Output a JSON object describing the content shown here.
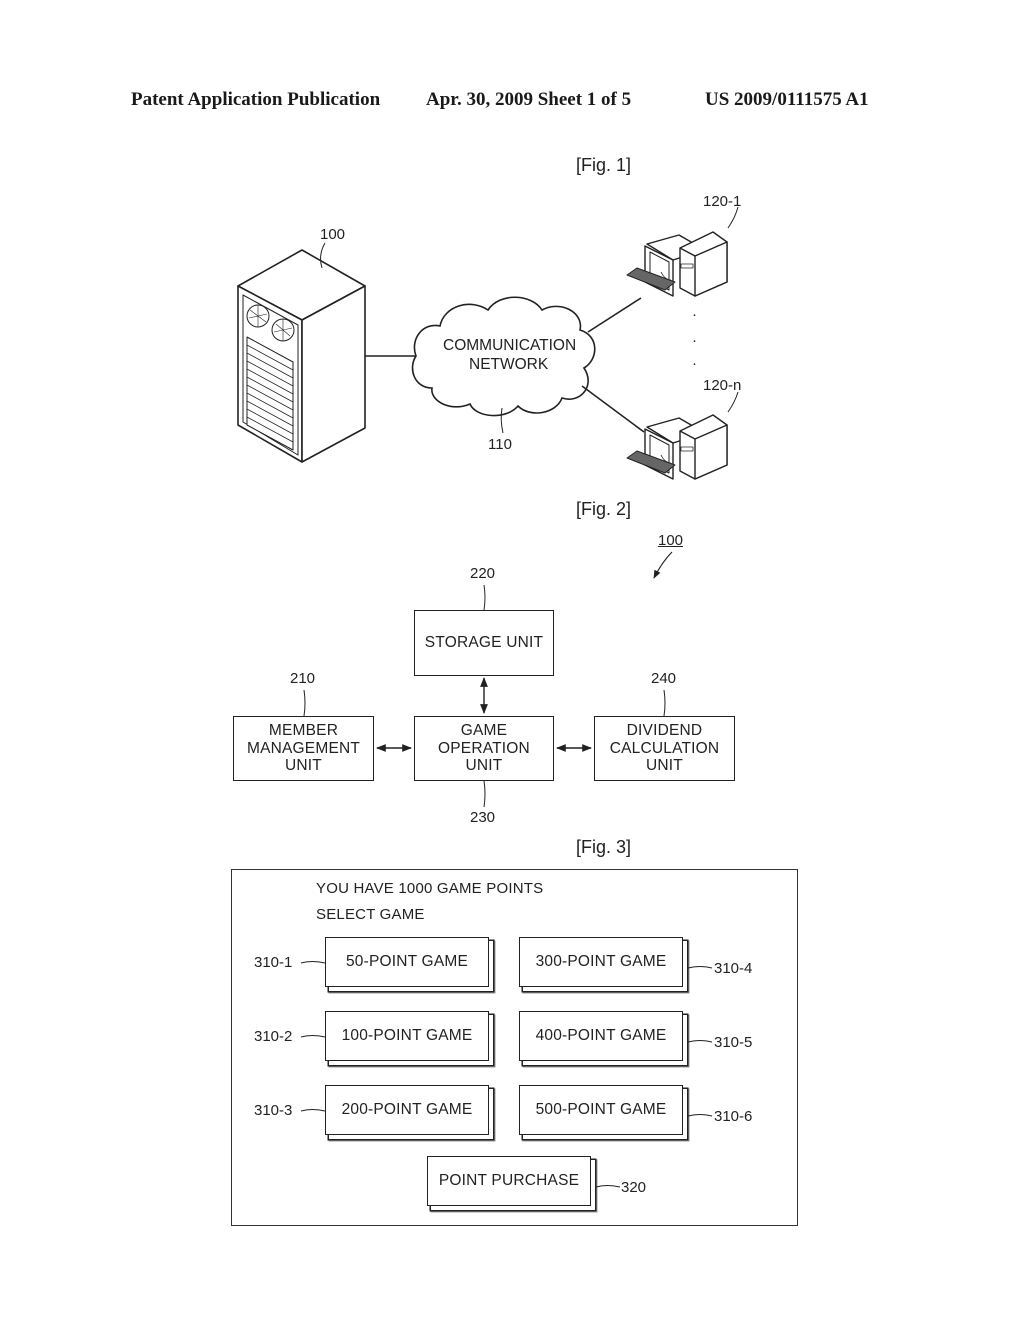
{
  "header": {
    "left": "Patent Application Publication",
    "center": "Apr. 30, 2009  Sheet 1 of 5",
    "right": "US 2009/0111575 A1"
  },
  "fig1": {
    "label": "[Fig. 1]",
    "server_ref": "100",
    "network_line1": "COMMUNICATION",
    "network_line2": "NETWORK",
    "network_ref": "110",
    "client_first_ref": "120-1",
    "client_last_ref": "120-n",
    "ellipsis": "·"
  },
  "fig2": {
    "label": "[Fig. 2]",
    "system_ref": "100",
    "blocks": {
      "storage": {
        "ref": "220",
        "label": "STORAGE UNIT"
      },
      "member": {
        "ref": "210",
        "label": "MEMBER\nMANAGEMENT\nUNIT"
      },
      "game": {
        "ref": "230",
        "label": "GAME\nOPERATION\nUNIT"
      },
      "dividend": {
        "ref": "240",
        "label": "DIVIDEND\nCALCULATION\nUNIT"
      }
    }
  },
  "fig3": {
    "label": "[Fig. 3]",
    "points_message": "YOU HAVE 1000 GAME POINTS",
    "prompt": "SELECT GAME",
    "games": [
      {
        "label": "50-POINT GAME",
        "ref": "310-1"
      },
      {
        "label": "100-POINT GAME",
        "ref": "310-2"
      },
      {
        "label": "200-POINT GAME",
        "ref": "310-3"
      },
      {
        "label": "300-POINT GAME",
        "ref": "310-4"
      },
      {
        "label": "400-POINT GAME",
        "ref": "310-5"
      },
      {
        "label": "500-POINT GAME",
        "ref": "310-6"
      }
    ],
    "purchase": {
      "label": "POINT PURCHASE",
      "ref": "320"
    }
  }
}
